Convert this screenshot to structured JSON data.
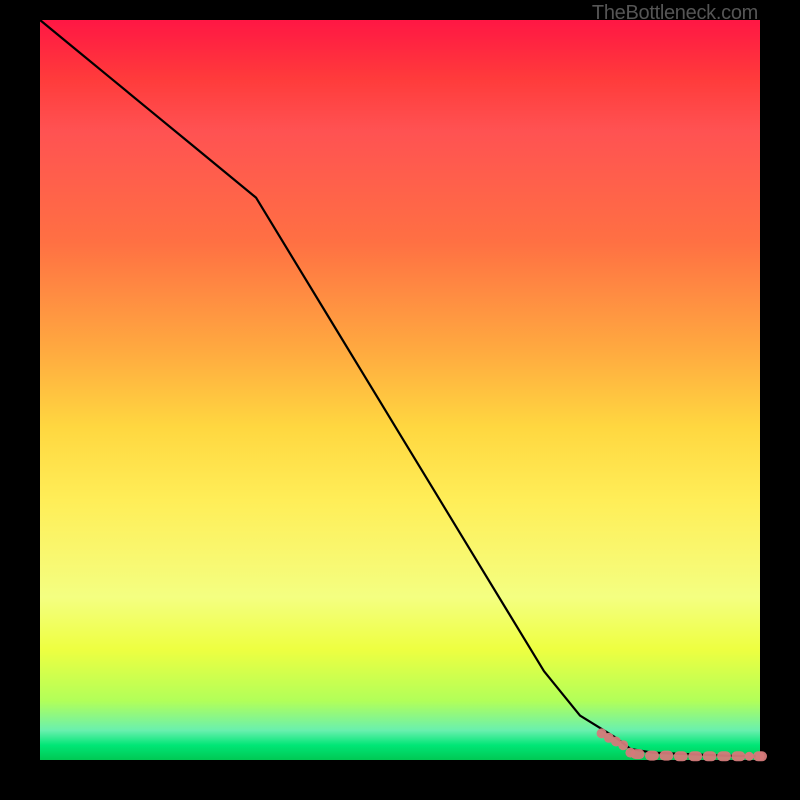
{
  "watermark": "TheBottleneck.com",
  "chart_data": {
    "type": "line",
    "title": "",
    "xlabel": "",
    "ylabel": "",
    "xlim": [
      0,
      100
    ],
    "ylim": [
      0,
      100
    ],
    "grid": false,
    "background": "red-yellow-green vertical gradient (red top = bad, green bottom = good)",
    "series": [
      {
        "name": "bottleneck-curve",
        "color": "#000000",
        "x": [
          0,
          5,
          10,
          15,
          20,
          25,
          30,
          35,
          40,
          45,
          50,
          55,
          60,
          65,
          70,
          75,
          80,
          82,
          85,
          90,
          95,
          100
        ],
        "values": [
          100,
          96,
          92,
          88,
          84,
          80,
          76,
          68,
          60,
          52,
          44,
          36,
          28,
          20,
          12,
          6,
          3,
          1.5,
          1,
          0.8,
          0.6,
          0.5
        ]
      },
      {
        "name": "data-points",
        "color": "#d47a7a",
        "style": "markers",
        "x": [
          78,
          79,
          80,
          81,
          82,
          83,
          85,
          87,
          89,
          91,
          93,
          95,
          97,
          100
        ],
        "values": [
          3.6,
          3.0,
          2.5,
          2.0,
          1.0,
          0.8,
          0.6,
          0.6,
          0.5,
          0.5,
          0.5,
          0.5,
          0.5,
          0.5
        ]
      }
    ]
  }
}
